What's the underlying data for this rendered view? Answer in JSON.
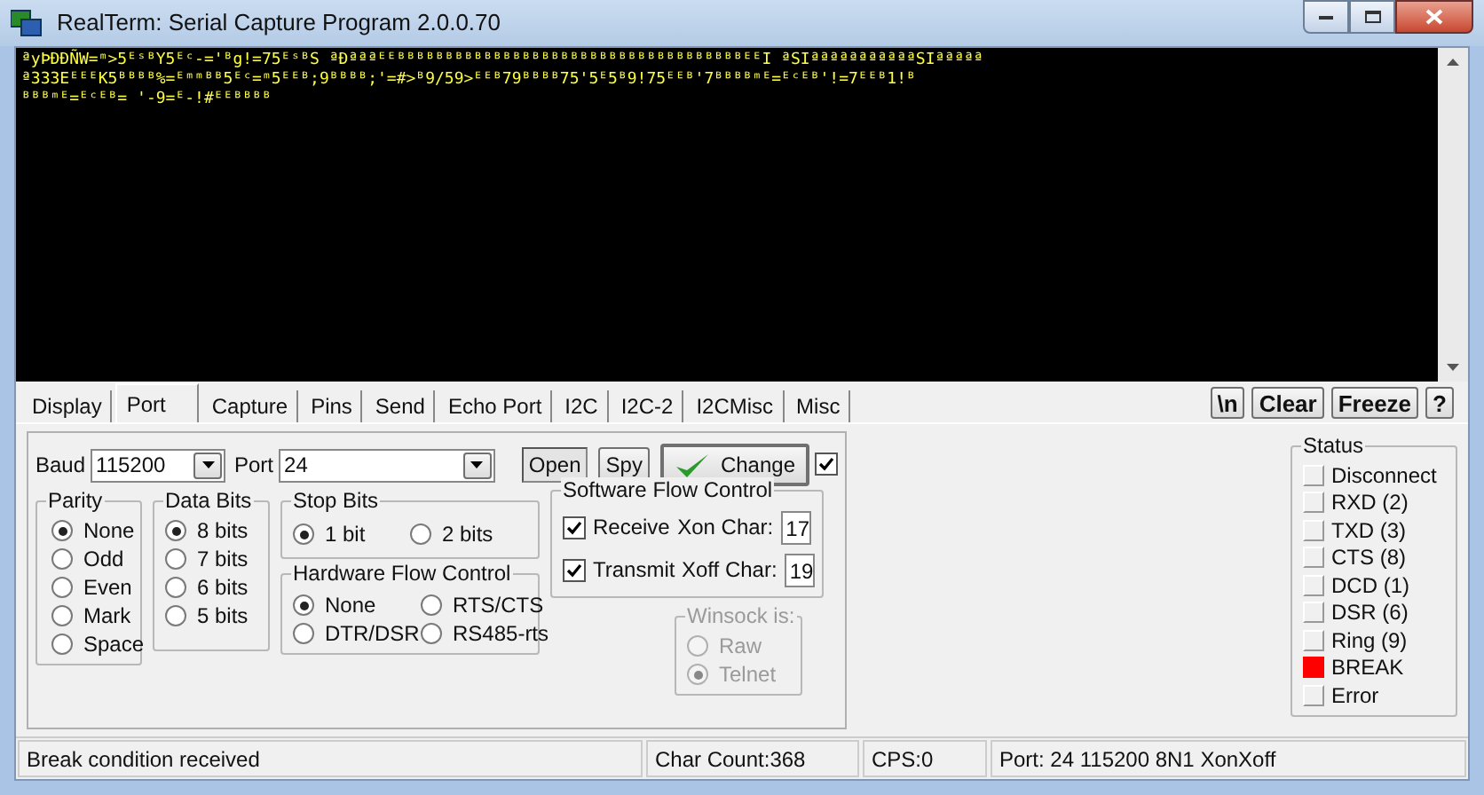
{
  "window": {
    "title": "RealTerm: Serial Capture Program 2.0.0.70"
  },
  "terminal": {
    "lines": [
      "ªyÞÐÐÑW=ᵐ>5ᴱˢᴮY5ᴱᶜ-='ᴮg!=75ᴱˢᴮS ªÐªªªᴱᴱᴮᴮᴮᴮᴮᴮᴮᴮᴮᴮᴮᴮᴮᴮᴮᴮᴮᴮᴮᴮᴮᴮᴮᴮᴮᴮᴮᴮᴮᴮᴮᴮᴮᴮᴮᴮᴱᴱI ªSIªªªªªªªªªªªSIªªªªª",
      "ª333EᴱᴱᴱK5ᴮᴮᴮᴮ%=ᴱᵐᵐᴮᴮ5ᴱᶜ=ᵐ5ᴱᴱᴮ;9ᴮᴮᴮᴮ;'=#>ᴮ9/59>ᴱᴱᴮ79ᴮᴮᴮᴮ75'5ᴱ5ᴮ9!75ᴱᴱᴮ'7ᴮᴮᴮᴮᵐᴱ=ᴱᶜᴱᴮ'!=7ᴱᴱᴮ1!ᴮ",
      "ᴮᴮᴮᵐᴱ=ᴱᶜᴱᴮ=   '-9=ᴱ-!#ᴱᴱᴮᴮᴮᴮ"
    ]
  },
  "tabs": [
    {
      "label": "Display",
      "selected": false
    },
    {
      "label": "Port",
      "selected": true
    },
    {
      "label": "Capture",
      "selected": false
    },
    {
      "label": "Pins",
      "selected": false
    },
    {
      "label": "Send",
      "selected": false
    },
    {
      "label": "Echo Port",
      "selected": false
    },
    {
      "label": "I2C",
      "selected": false
    },
    {
      "label": "I2C-2",
      "selected": false
    },
    {
      "label": "I2CMisc",
      "selected": false
    },
    {
      "label": "Misc",
      "selected": false
    }
  ],
  "toolbar_buttons": [
    "\\n",
    "Clear",
    "Freeze",
    "?"
  ],
  "port": {
    "baud_label": "Baud",
    "baud": "115200",
    "port_label": "Port",
    "port": "24",
    "open": {
      "label": "Open",
      "selected": true
    },
    "spy": {
      "label": "Spy",
      "selected": false
    },
    "change": "Change",
    "change_checked": true
  },
  "parity": {
    "title": "Parity",
    "options": [
      {
        "label": "None",
        "selected": true
      },
      {
        "label": "Odd",
        "selected": false
      },
      {
        "label": "Even",
        "selected": false
      },
      {
        "label": "Mark",
        "selected": false
      },
      {
        "label": "Space",
        "selected": false
      }
    ]
  },
  "data_bits": {
    "title": "Data Bits",
    "options": [
      {
        "label": "8 bits",
        "selected": true
      },
      {
        "label": "7 bits",
        "selected": false
      },
      {
        "label": "6 bits",
        "selected": false
      },
      {
        "label": "5 bits",
        "selected": false
      }
    ]
  },
  "stop_bits": {
    "title": "Stop Bits",
    "options": [
      {
        "label": "1 bit",
        "selected": true
      },
      {
        "label": "2 bits",
        "selected": false
      }
    ]
  },
  "hardware_flow": {
    "title": "Hardware Flow Control",
    "options": [
      {
        "label": "None",
        "selected": true
      },
      {
        "label": "RTS/CTS",
        "selected": false
      },
      {
        "label": "DTR/DSR",
        "selected": false
      },
      {
        "label": "RS485-rts",
        "selected": false
      }
    ]
  },
  "software_flow": {
    "title": "Software Flow Control",
    "rows": [
      {
        "label": "Receive",
        "checked": true,
        "char_label": "Xon Char:",
        "value": "17"
      },
      {
        "label": "Transmit",
        "checked": true,
        "char_label": "Xoff Char:",
        "value": "19"
      }
    ]
  },
  "winsock": {
    "title": "Winsock is:",
    "disabled": true,
    "options": [
      {
        "label": "Raw",
        "selected": false
      },
      {
        "label": "Telnet",
        "selected": true
      }
    ]
  },
  "status": {
    "title": "Status",
    "items": [
      {
        "label": "Disconnect",
        "on": false
      },
      {
        "label": "RXD (2)",
        "on": false
      },
      {
        "label": "TXD (3)",
        "on": false
      },
      {
        "label": "CTS (8)",
        "on": false
      },
      {
        "label": "DCD (1)",
        "on": false
      },
      {
        "label": "DSR (6)",
        "on": false
      },
      {
        "label": "Ring (9)",
        "on": false
      },
      {
        "label": "BREAK",
        "on": true
      },
      {
        "label": "Error",
        "on": false
      }
    ]
  },
  "status_bar": [
    "Break condition received",
    "Char Count:368",
    "CPS:0",
    "Port: 24 115200 8N1 XonXoff"
  ]
}
